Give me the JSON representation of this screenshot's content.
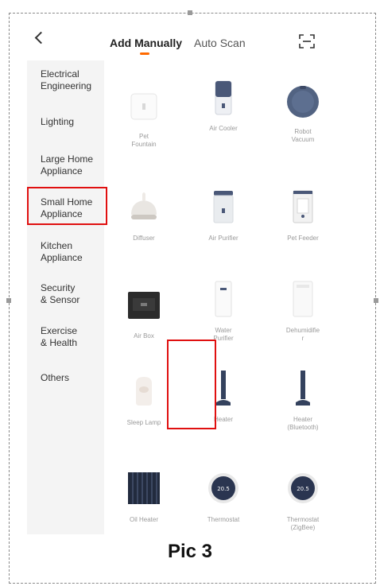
{
  "header": {
    "tabs": [
      "Add Manually",
      "Auto Scan"
    ]
  },
  "sidebar": {
    "items": [
      {
        "label": "Electrical\nEngineering"
      },
      {
        "label": "Lighting"
      },
      {
        "label": "Large Home\nAppliance"
      },
      {
        "label": "Small Home\nAppliance",
        "highlighted": true
      },
      {
        "label": "Kitchen\nAppliance"
      },
      {
        "label": "Security\n& Sensor"
      },
      {
        "label": "Exercise\n& Health"
      },
      {
        "label": "Others"
      }
    ]
  },
  "devices": [
    {
      "label": "Pet\nFountain",
      "icon": "pet-fountain-icon"
    },
    {
      "label": "Air Cooler",
      "icon": "air-cooler-icon"
    },
    {
      "label": "Robot\nVacuum",
      "icon": "robot-vacuum-icon"
    },
    {
      "label": "Diffuser",
      "icon": "diffuser-icon"
    },
    {
      "label": "Air Purifier",
      "icon": "air-purifier-icon"
    },
    {
      "label": "Pet Feeder",
      "icon": "pet-feeder-icon"
    },
    {
      "label": "Air Box",
      "icon": "air-box-icon"
    },
    {
      "label": "Water\nPurifier",
      "icon": "water-purifier-icon"
    },
    {
      "label": "Dehumidifie\nr",
      "icon": "dehumidifier-icon"
    },
    {
      "label": "Sleep Lamp",
      "icon": "sleep-lamp-icon"
    },
    {
      "label": "Heater",
      "icon": "heater-icon",
      "highlighted": true
    },
    {
      "label": "Heater\n(Bluetooth)",
      "icon": "heater-bluetooth-icon"
    },
    {
      "label": "Oil Heater",
      "icon": "oil-heater-icon"
    },
    {
      "label": "Thermostat",
      "icon": "thermostat-icon",
      "display": "20.5"
    },
    {
      "label": "Thermostat\n(ZigBee)",
      "icon": "thermostat-zigbee-icon",
      "display": "20.5"
    }
  ],
  "caption": "Pic 3",
  "colors": {
    "accent": "#ff6a00",
    "highlight": "#e01010",
    "sidebar_bg": "#f4f4f4"
  }
}
